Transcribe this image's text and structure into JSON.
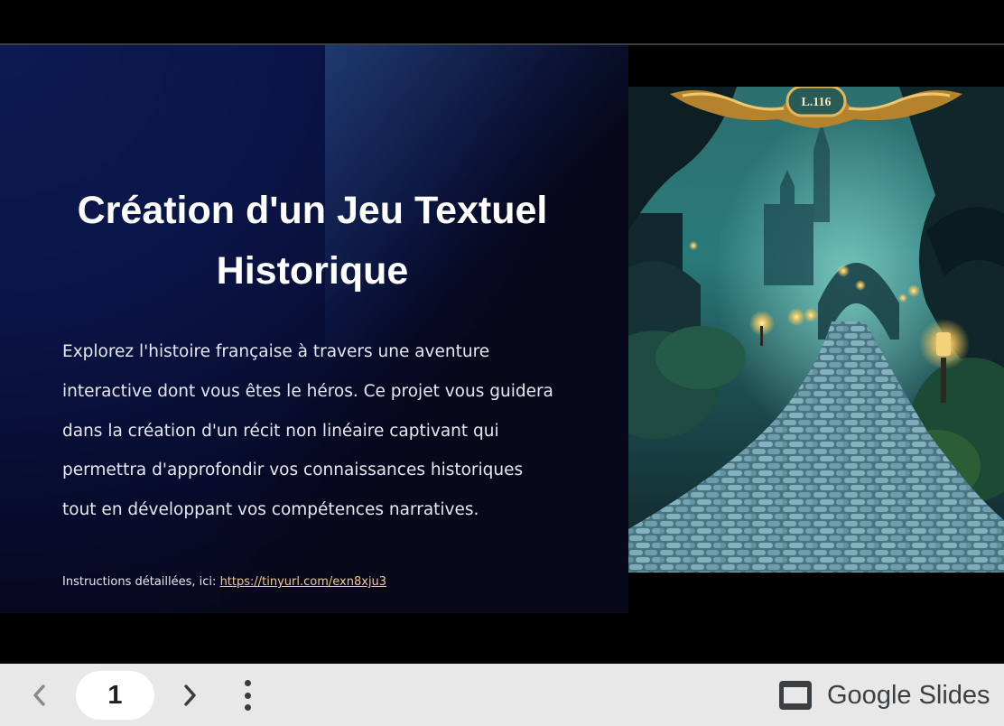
{
  "slide": {
    "title_line1": "Création d'un Jeu Textuel",
    "title_line2": "Historique",
    "body_lines": [
      "Explorez l'histoire française à travers une aventure",
      "interactive dont vous êtes le héros. Ce projet vous guidera",
      "dans la création d'un récit non linéaire captivant qui",
      "permettra d'approfondir vos connaissances historiques",
      "tout en développant vos compétences narratives."
    ],
    "instructions_label": "Instructions détaillées, ici: ",
    "instructions_link": "https://tinyurl.com/exn8xju3",
    "plaque_text": "L.116"
  },
  "toolbar": {
    "page_number": "1",
    "brand": "Google Slides"
  },
  "icons": {
    "prev": "chevron-left-icon",
    "next": "chevron-right-icon",
    "menu": "more-vertical-icon",
    "brand": "presentation-icon"
  },
  "colors": {
    "toolbar_bg": "#e8e8e8",
    "link": "#f2c98a",
    "slide_bg": "#07081a"
  }
}
